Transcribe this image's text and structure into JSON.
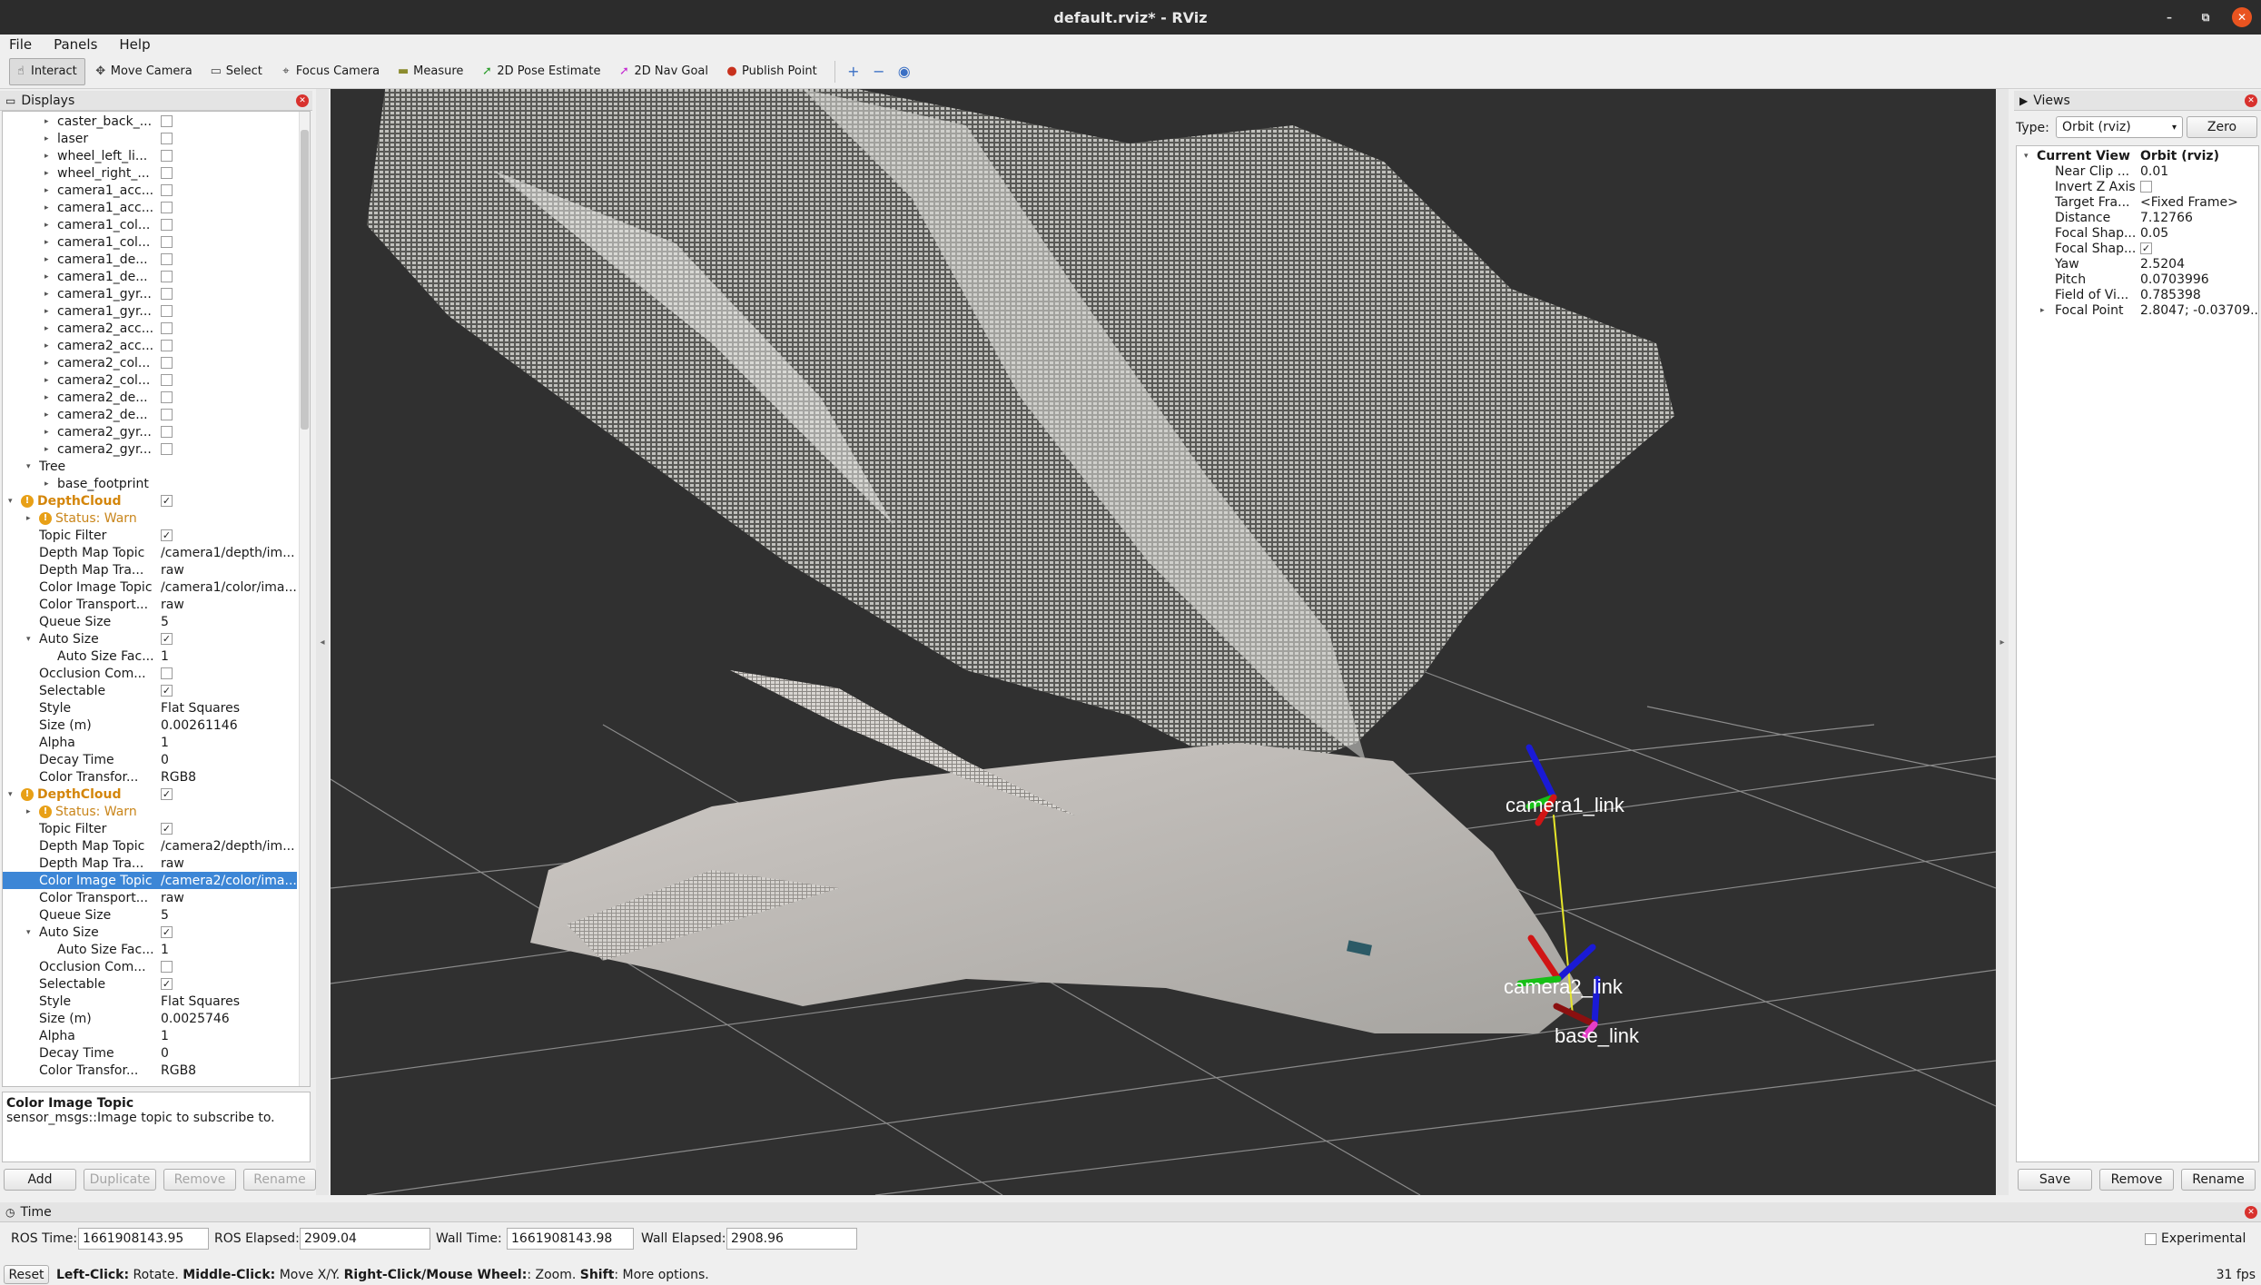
{
  "window": {
    "title": "default.rviz* - RViz",
    "controls": [
      "–",
      "⧉",
      "✕"
    ]
  },
  "menu": [
    "File",
    "Panels",
    "Help"
  ],
  "toolbar": {
    "tools": [
      {
        "label": "Interact",
        "icon": "interact-icon",
        "glyph": "☝",
        "active": true
      },
      {
        "label": "Move Camera",
        "icon": "move-camera-icon",
        "glyph": "✥",
        "active": false
      },
      {
        "label": "Select",
        "icon": "select-icon",
        "glyph": "▭",
        "active": false
      },
      {
        "label": "Focus Camera",
        "icon": "focus-camera-icon",
        "glyph": "⌖",
        "active": false
      },
      {
        "label": "Measure",
        "icon": "measure-icon",
        "glyph": "▬",
        "active": false
      },
      {
        "label": "2D Pose Estimate",
        "icon": "pose-estimate-icon",
        "glyph": "➚",
        "active": false
      },
      {
        "label": "2D Nav Goal",
        "icon": "nav-goal-icon",
        "glyph": "➚",
        "active": false
      },
      {
        "label": "Publish Point",
        "icon": "publish-point-icon",
        "glyph": "●",
        "active": false
      }
    ],
    "extra_icons": [
      {
        "name": "add-tool-icon",
        "glyph": "+"
      },
      {
        "name": "remove-tool-icon",
        "glyph": "−"
      },
      {
        "name": "camera-type-icon",
        "glyph": "◉"
      }
    ],
    "colors": {
      "pose": "#2e9e2e",
      "nav": "#c42bd1",
      "publish": "#c8311d",
      "measure": "#8b8b2e"
    }
  },
  "displays": {
    "title": "Displays",
    "rows": [
      {
        "label": "caster_back_...",
        "indent": 3,
        "arrow": "▸",
        "check": false
      },
      {
        "label": "laser",
        "indent": 3,
        "arrow": "▸",
        "check": false
      },
      {
        "label": "wheel_left_li...",
        "indent": 3,
        "arrow": "▸",
        "check": false
      },
      {
        "label": "wheel_right_...",
        "indent": 3,
        "arrow": "▸",
        "check": false
      },
      {
        "label": "camera1_acc...",
        "indent": 3,
        "arrow": "▸",
        "check": false
      },
      {
        "label": "camera1_acc...",
        "indent": 3,
        "arrow": "▸",
        "check": false
      },
      {
        "label": "camera1_col...",
        "indent": 3,
        "arrow": "▸",
        "check": false
      },
      {
        "label": "camera1_col...",
        "indent": 3,
        "arrow": "▸",
        "check": false
      },
      {
        "label": "camera1_de...",
        "indent": 3,
        "arrow": "▸",
        "check": false
      },
      {
        "label": "camera1_de...",
        "indent": 3,
        "arrow": "▸",
        "check": false
      },
      {
        "label": "camera1_gyr...",
        "indent": 3,
        "arrow": "▸",
        "check": false
      },
      {
        "label": "camera1_gyr...",
        "indent": 3,
        "arrow": "▸",
        "check": false
      },
      {
        "label": "camera2_acc...",
        "indent": 3,
        "arrow": "▸",
        "check": false
      },
      {
        "label": "camera2_acc...",
        "indent": 3,
        "arrow": "▸",
        "check": false
      },
      {
        "label": "camera2_col...",
        "indent": 3,
        "arrow": "▸",
        "check": false
      },
      {
        "label": "camera2_col...",
        "indent": 3,
        "arrow": "▸",
        "check": false
      },
      {
        "label": "camera2_de...",
        "indent": 3,
        "arrow": "▸",
        "check": false
      },
      {
        "label": "camera2_de...",
        "indent": 3,
        "arrow": "▸",
        "check": false
      },
      {
        "label": "camera2_gyr...",
        "indent": 3,
        "arrow": "▸",
        "check": false
      },
      {
        "label": "camera2_gyr...",
        "indent": 3,
        "arrow": "▸",
        "check": false
      },
      {
        "label": "Tree",
        "indent": 2,
        "arrow": "▾"
      },
      {
        "label": "base_footprint",
        "indent": 3,
        "arrow": "▸"
      },
      {
        "label": "DepthCloud",
        "indent": 1,
        "arrow": "▾",
        "check": true,
        "kind": "warn"
      },
      {
        "label": "Status: Warn",
        "indent": 2,
        "arrow": "▸",
        "kind": "status"
      },
      {
        "label": "Topic Filter",
        "indent": 2,
        "check": true
      },
      {
        "label": "Depth Map Topic",
        "indent": 2,
        "value": "/camera1/depth/im..."
      },
      {
        "label": "Depth Map Tra...",
        "indent": 2,
        "value": "raw"
      },
      {
        "label": "Color Image Topic",
        "indent": 2,
        "value": "/camera1/color/ima..."
      },
      {
        "label": "Color Transport...",
        "indent": 2,
        "value": "raw"
      },
      {
        "label": "Queue Size",
        "indent": 2,
        "value": "5"
      },
      {
        "label": "Auto Size",
        "indent": 2,
        "arrow": "▾",
        "check": true
      },
      {
        "label": "Auto Size Fac...",
        "indent": 3,
        "value": "1"
      },
      {
        "label": "Occlusion Com...",
        "indent": 2,
        "check": false
      },
      {
        "label": "Selectable",
        "indent": 2,
        "check": true
      },
      {
        "label": "Style",
        "indent": 2,
        "value": "Flat Squares"
      },
      {
        "label": "Size (m)",
        "indent": 2,
        "value": "0.00261146"
      },
      {
        "label": "Alpha",
        "indent": 2,
        "value": "1"
      },
      {
        "label": "Decay Time",
        "indent": 2,
        "value": "0"
      },
      {
        "label": "Color Transfor...",
        "indent": 2,
        "value": "RGB8"
      },
      {
        "label": "DepthCloud",
        "indent": 1,
        "arrow": "▾",
        "check": true,
        "kind": "warn"
      },
      {
        "label": "Status: Warn",
        "indent": 2,
        "arrow": "▸",
        "kind": "status"
      },
      {
        "label": "Topic Filter",
        "indent": 2,
        "check": true
      },
      {
        "label": "Depth Map Topic",
        "indent": 2,
        "value": "/camera2/depth/im..."
      },
      {
        "label": "Depth Map Tra...",
        "indent": 2,
        "value": "raw"
      },
      {
        "label": "Color Image Topic",
        "indent": 2,
        "value": "/camera2/color/ima...",
        "selected": true
      },
      {
        "label": "Color Transport...",
        "indent": 2,
        "value": "raw"
      },
      {
        "label": "Queue Size",
        "indent": 2,
        "value": "5"
      },
      {
        "label": "Auto Size",
        "indent": 2,
        "arrow": "▾",
        "check": true
      },
      {
        "label": "Auto Size Fac...",
        "indent": 3,
        "value": "1"
      },
      {
        "label": "Occlusion Com...",
        "indent": 2,
        "check": false
      },
      {
        "label": "Selectable",
        "indent": 2,
        "check": true
      },
      {
        "label": "Style",
        "indent": 2,
        "value": "Flat Squares"
      },
      {
        "label": "Size (m)",
        "indent": 2,
        "value": "0.0025746"
      },
      {
        "label": "Alpha",
        "indent": 2,
        "value": "1"
      },
      {
        "label": "Decay Time",
        "indent": 2,
        "value": "0"
      },
      {
        "label": "Color Transfor...",
        "indent": 2,
        "value": "RGB8"
      }
    ],
    "help_title": "Color Image Topic",
    "help_text": "sensor_msgs::Image topic to subscribe to.",
    "buttons": {
      "add": "Add",
      "duplicate": "Duplicate",
      "remove": "Remove",
      "rename": "Rename"
    }
  },
  "viewport": {
    "frames": [
      "camera1_link",
      "camera2_link",
      "base_link"
    ],
    "colors": {
      "background": "#303030",
      "grid": "#8a8a8a",
      "cloud": "#d8d8d4",
      "x_axis": "#d01515",
      "y_axis": "#16c016",
      "z_axis": "#1a1ad6",
      "link": "#e6e62a"
    }
  },
  "views": {
    "title": "Views",
    "type_label": "Type:",
    "type_value": "Orbit (rviz)",
    "zero_button": "Zero",
    "rows": [
      {
        "label": "Current View",
        "value": "Orbit (rviz)",
        "bold": true,
        "arrow": "▾"
      },
      {
        "label": "Near Clip ...",
        "value": "0.01"
      },
      {
        "label": "Invert Z Axis",
        "check": false
      },
      {
        "label": "Target Fra...",
        "value": "<Fixed Frame>"
      },
      {
        "label": "Distance",
        "value": "7.12766"
      },
      {
        "label": "Focal Shap...",
        "value": "0.05"
      },
      {
        "label": "Focal Shap...",
        "check": true
      },
      {
        "label": "Yaw",
        "value": "2.5204"
      },
      {
        "label": "Pitch",
        "value": "0.0703996"
      },
      {
        "label": "Field of Vi...",
        "value": "0.785398"
      },
      {
        "label": "Focal Point",
        "value": "2.8047; -0.03709...",
        "arrow": "▸"
      }
    ],
    "buttons": {
      "save": "Save",
      "remove": "Remove",
      "rename": "Rename"
    }
  },
  "time": {
    "title": "Time",
    "ros_time_label": "ROS Time:",
    "ros_time": "1661908143.95",
    "ros_elapsed_label": "ROS Elapsed:",
    "ros_elapsed": "2909.04",
    "wall_time_label": "Wall Time:",
    "wall_time": "1661908143.98",
    "wall_elapsed_label": "Wall Elapsed:",
    "wall_elapsed": "2908.96",
    "experimental": "Experimental"
  },
  "status": {
    "reset": "Reset",
    "hint_parts": [
      {
        "b": "Left-Click:",
        "t": " Rotate. "
      },
      {
        "b": "Middle-Click:",
        "t": " Move X/Y. "
      },
      {
        "b": "Right-Click/Mouse Wheel:",
        "t": ": Zoom. "
      },
      {
        "b": "Shift",
        "t": ": More options."
      }
    ],
    "fps": "31 fps"
  }
}
